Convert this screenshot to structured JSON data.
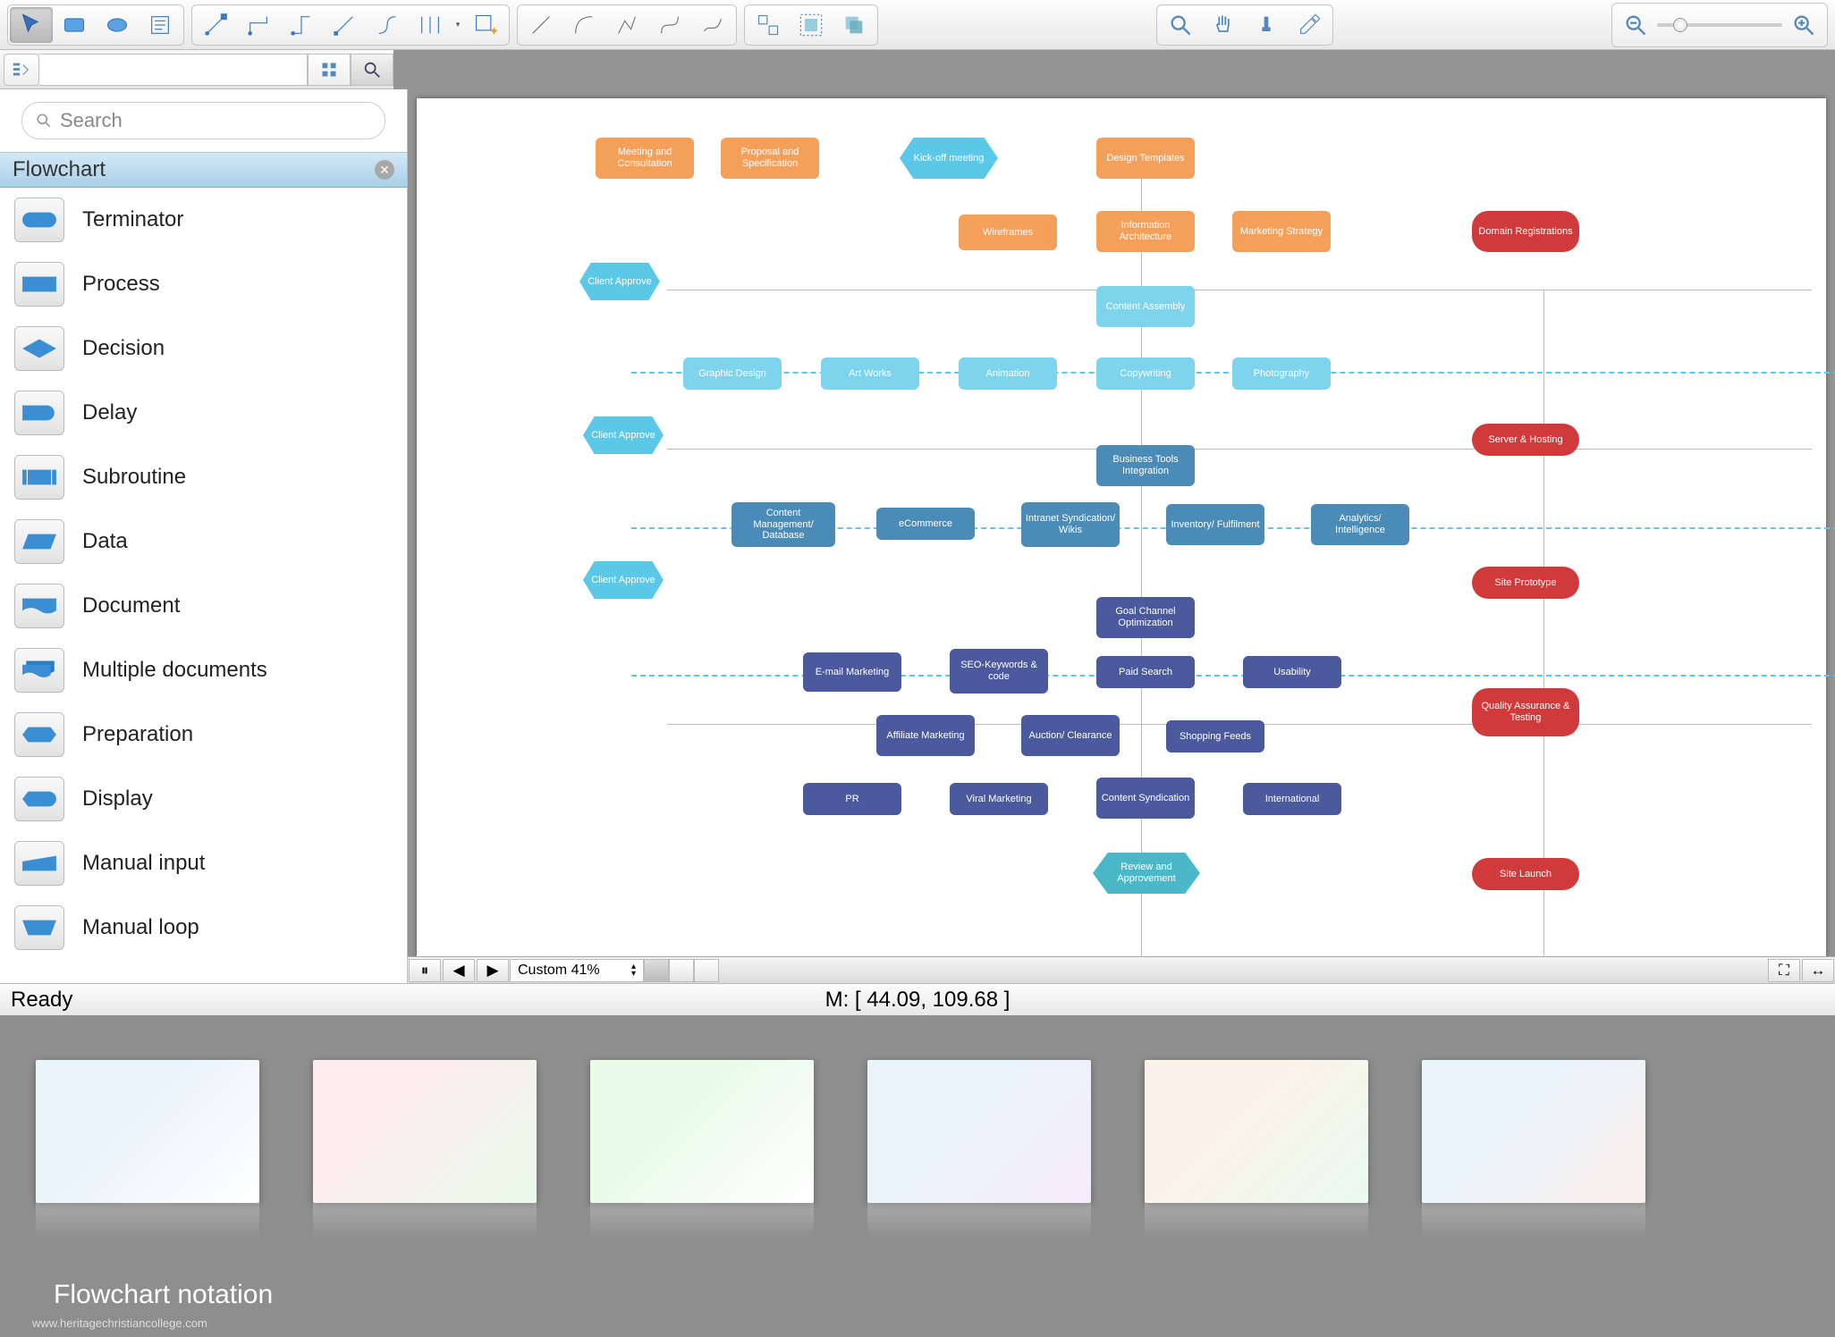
{
  "search": {
    "placeholder": "Search"
  },
  "sidebar": {
    "header": "Flowchart",
    "stencils": [
      "Terminator",
      "Process",
      "Decision",
      "Delay",
      "Subroutine",
      "Data",
      "Document",
      "Multiple documents",
      "Preparation",
      "Display",
      "Manual input",
      "Manual loop"
    ]
  },
  "bottom": {
    "zoom_label": "Custom 41%"
  },
  "status": {
    "ready": "Ready",
    "coords": "M: [ 44.09, 109.68 ]"
  },
  "gallery": {
    "caption": "Flowchart notation",
    "sub": "www.heritagechristiancollege.com"
  },
  "flow": {
    "row1": [
      "Meeting and Consultation",
      "Proposal and Specification",
      "Kick-off meeting",
      "Design Templates"
    ],
    "row2": [
      "Wireframes",
      "Information Architecture",
      "Marketing Strategy"
    ],
    "approve": "Client Approve",
    "content_assembly": "Content Assembly",
    "row3": [
      "Graphic Design",
      "Art Works",
      "Animation",
      "Copywriting",
      "Photography"
    ],
    "bti": "Business Tools Integration",
    "row4": [
      "Content Management/ Database",
      "eCommerce",
      "Intranet Syndication/ Wikis",
      "Inventory/ Fulfilment",
      "Analytics/ Intelligence"
    ],
    "gco": "Goal Channel Optimization",
    "row5": [
      "E-mail Marketing",
      "SEO-Keywords & code",
      "Paid Search",
      "Usability"
    ],
    "row6": [
      "Affiliate Marketing",
      "Auction/ Clearance",
      "Shopping Feeds"
    ],
    "row7": [
      "PR",
      "Viral Marketing",
      "Content Syndication",
      "International"
    ],
    "review": "Review and Approvement",
    "reds": [
      "Domain Registrations",
      "Server & Hosting",
      "Site Prototype",
      "Quality Assurance & Testing",
      "Site Launch"
    ]
  }
}
